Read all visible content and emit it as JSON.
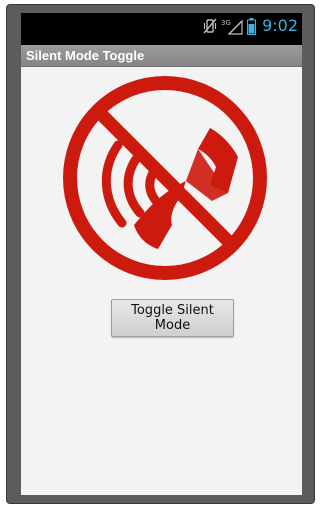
{
  "status_bar": {
    "network_label": "3G",
    "time": "9:02",
    "clock_color": "#33b5e5",
    "icons": [
      "vibrate-icon",
      "signal-icon",
      "battery-icon"
    ]
  },
  "app": {
    "title": "Silent Mode Toggle"
  },
  "main": {
    "graphic": "silent-mode-icon",
    "graphic_color": "#cc1a0e",
    "toggle_button_label": "Toggle Silent Mode"
  }
}
